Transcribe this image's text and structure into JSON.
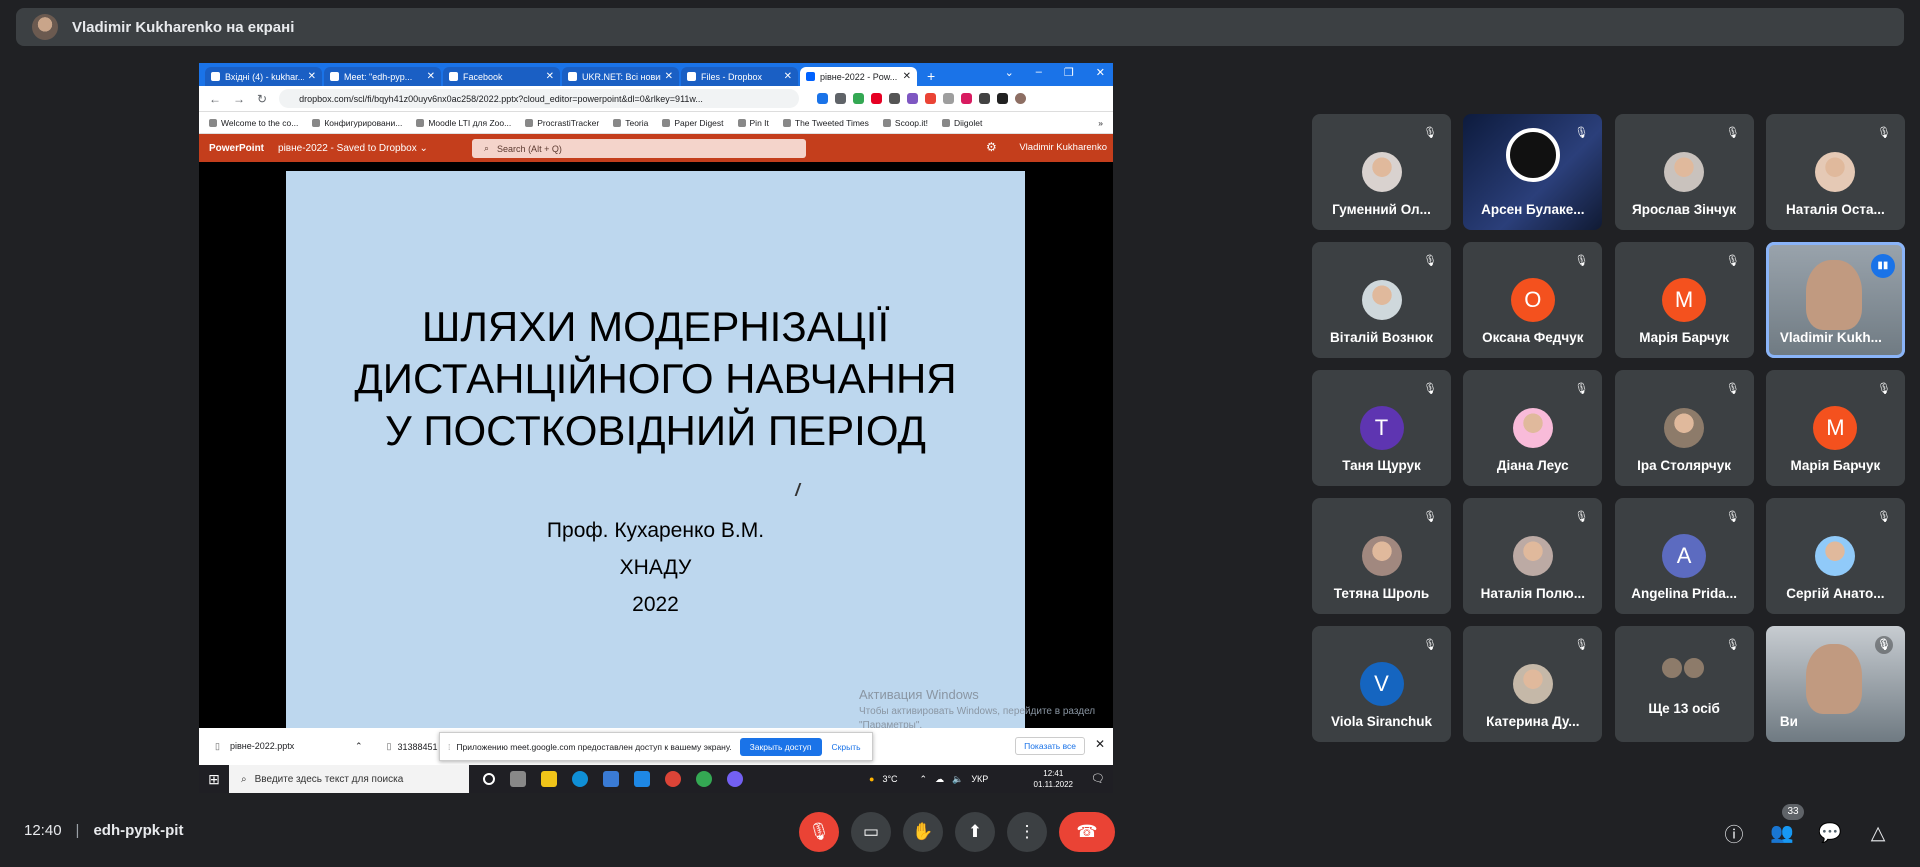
{
  "banner": {
    "text": "Vladimir Kukharenko на екрані"
  },
  "browser": {
    "tabs": [
      "Вхідні (4) - kukhar...",
      "Meet: \"edh-pyp...",
      "Facebook",
      "UKR.NET: Всі новин...",
      "Files - Dropbox",
      "рівне-2022 - Pow..."
    ],
    "new_tab": "+",
    "url": "dropbox.com/scl/fi/bqyh41z00uyv6nx0ac258/2022.pptx?cloud_editor=powerpoint&dl=0&rlkey=911w...",
    "bookmarks": [
      "Welcome to the co...",
      "Конфигурировани...",
      "Moodle LTI для Zoo...",
      "ProcrastiTracker",
      "Teoria",
      "Paper Digest",
      "Pin It",
      "The Tweeted Times",
      "Scoop.it!",
      "Diigolet"
    ],
    "bookmarks_more": "»"
  },
  "powerpoint": {
    "app": "PowerPoint",
    "doc": "рівне-2022 - Saved to Dropbox ⌄",
    "search_placeholder": "Search (Alt + Q)",
    "user": "Vladimir Kukharenko"
  },
  "slide": {
    "title_lines": [
      "ШЛЯХИ МОДЕРНІЗАЦІЇ",
      "ДИСТАНЦІЙНОГО НАВЧАННЯ",
      "У ПОСТКОВІДНИЙ ПЕРІОД"
    ],
    "author": "Проф. Кухаренко В.М.",
    "org": "ХНАДУ",
    "year": "2022"
  },
  "windows_watermark": {
    "title": "Активация Windows",
    "text": "Чтобы активировать Windows, перейдите в раздел \"Параметры\"."
  },
  "downloads": {
    "file1": "рівне-2022.pptx",
    "file2": "31388451",
    "notice": "Приложению meet.google.com предоставлен доступ к вашему экрану.",
    "stop_share": "Закрыть доступ",
    "hide": "Скрыть",
    "show_all": "Показать все"
  },
  "taskbar": {
    "search_placeholder": "Введите здесь текст для поиска",
    "weather": "3°C",
    "lang": "УКР",
    "time": "12:41",
    "date": "01.11.2022"
  },
  "participants": [
    {
      "name": "Гуменний Ол...",
      "type": "photo",
      "color": "#d9d2cf"
    },
    {
      "name": "Арсен Булаке...",
      "type": "obs",
      "color": "#1e2a4d"
    },
    {
      "name": "Ярослав Зінчук",
      "type": "photo",
      "color": "#c9c2bd"
    },
    {
      "name": "Наталія Оста...",
      "type": "photo",
      "color": "#e5c9b5"
    },
    {
      "name": "Віталій Вознюк",
      "type": "photo",
      "color": "#cfd8dc"
    },
    {
      "name": "Оксана Федчук",
      "type": "letter",
      "letter": "О",
      "color": "#f4511e"
    },
    {
      "name": "Марія Барчук",
      "type": "letter",
      "letter": "M",
      "color": "#f4511e"
    },
    {
      "name": "Vladimir Kukh...",
      "type": "video",
      "color": "#9aa4ad"
    },
    {
      "name": "Таня Щурук",
      "type": "letter",
      "letter": "T",
      "color": "#5e35b1"
    },
    {
      "name": "Діана Леус",
      "type": "photo",
      "color": "#f8bbd9"
    },
    {
      "name": "Іра Столярчук",
      "type": "photo",
      "color": "#8d7b6a"
    },
    {
      "name": "Марія Барчук",
      "type": "letter",
      "letter": "M",
      "color": "#f4511e"
    },
    {
      "name": "Тетяна Шроль",
      "type": "photo",
      "color": "#a1887f"
    },
    {
      "name": "Наталія Полю...",
      "type": "photo",
      "color": "#bcaaa4"
    },
    {
      "name": "Angelina Prida...",
      "type": "letter",
      "letter": "A",
      "color": "#5c6bc0"
    },
    {
      "name": "Сергій Анато...",
      "type": "photo",
      "color": "#90caf9"
    },
    {
      "name": "Viola Siranchuk",
      "type": "letter",
      "letter": "V",
      "color": "#1565c0"
    },
    {
      "name": "Катерина Ду...",
      "type": "photo",
      "color": "#c5b8a8"
    },
    {
      "name": "Ще 13 осіб",
      "type": "more",
      "color": "#8d7b6a"
    },
    {
      "name": "Ви",
      "type": "video",
      "color": "#c7ccd1"
    }
  ],
  "bottom": {
    "time": "12:40",
    "separator": "|",
    "meeting_code": "edh-pypk-pit",
    "people_count": "33"
  },
  "icons": {
    "mic_off": "🎙",
    "camera": "▭",
    "hand": "✋",
    "present": "⬆",
    "more": "⋮",
    "leave": "☎",
    "info": "ⓘ",
    "people": "👥",
    "chat": "💬",
    "activities": "△"
  }
}
